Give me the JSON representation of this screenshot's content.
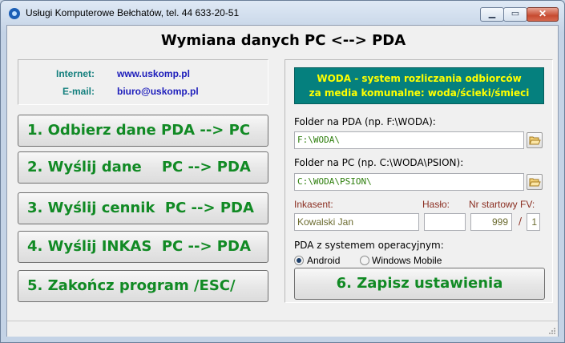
{
  "window": {
    "title": "Usługi Komputerowe Bełchatów, tel. 44 633-20-51",
    "minimize_glyph": "▁",
    "maximize_glyph": "▭",
    "close_glyph": "✕"
  },
  "heading": "Wymiana danych PC <--> PDA",
  "contact": {
    "internet_label": "Internet:",
    "internet_value": "www.uskomp.pl",
    "email_label": "E-mail:",
    "email_value": "biuro@uskomp.pl"
  },
  "actions": [
    {
      "label": "1. Odbierz dane PDA --> PC"
    },
    {
      "label": "2. Wyślij dane    PC --> PDA"
    },
    {
      "label": "3. Wyślij cennik  PC --> PDA"
    },
    {
      "label": "4. Wyślij INKAS  PC --> PDA"
    },
    {
      "label": "5. Zakończ program /ESC/"
    }
  ],
  "banner": {
    "line1": "WODA - system rozliczania odbiorców",
    "line2": "za media komunalne: woda/ścieki/śmieci"
  },
  "pda_folder": {
    "label": "Folder na PDA (np. F:\\WODA):",
    "value": "F:\\WODA\\"
  },
  "pc_folder": {
    "label": "Folder na PC (np. C:\\WODA\\PSION):",
    "value": "C:\\WODA\\PSION\\"
  },
  "collector": {
    "inkasent_label": "Inkasent:",
    "inkasent_value": "Kowalski Jan",
    "password_label": "Hasło:",
    "password_value": "",
    "start_no_label": "Nr startowy FV:",
    "start_no_value": "999",
    "separator": "/",
    "series_value": "1"
  },
  "os": {
    "label": "PDA z systemem operacyjnym:",
    "options": [
      {
        "label": "Android",
        "selected": true
      },
      {
        "label": "Windows Mobile",
        "selected": false
      }
    ]
  },
  "save_label": "6. Zapisz ustawienia",
  "colors": {
    "accent_green": "#118a24",
    "banner_bg": "#05807e",
    "banner_text": "#ffff00",
    "link_blue": "#1d1dbb",
    "label_teal": "#15807e"
  },
  "icons": {
    "app": "app-icon",
    "browse": "folder-open-icon"
  }
}
